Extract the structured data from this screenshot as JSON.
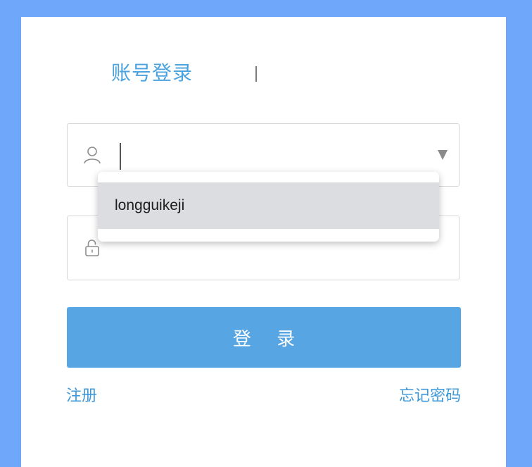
{
  "form": {
    "title": "账号登录",
    "username": {
      "icon": "user-icon",
      "value": "",
      "dropdown_icon": "dropdown-arrow-icon"
    },
    "password": {
      "icon": "lock-icon",
      "value": ""
    },
    "autocomplete": {
      "options": [
        "longguikeji"
      ]
    },
    "submit_label": "登 录",
    "register_link": "注册",
    "forgot_link": "忘记密码"
  },
  "colors": {
    "background": "#6fa8fb",
    "card": "#ffffff",
    "accent": "#4aa3df",
    "button": "#57a5e3",
    "suggestion_highlight": "#dcdde1"
  }
}
